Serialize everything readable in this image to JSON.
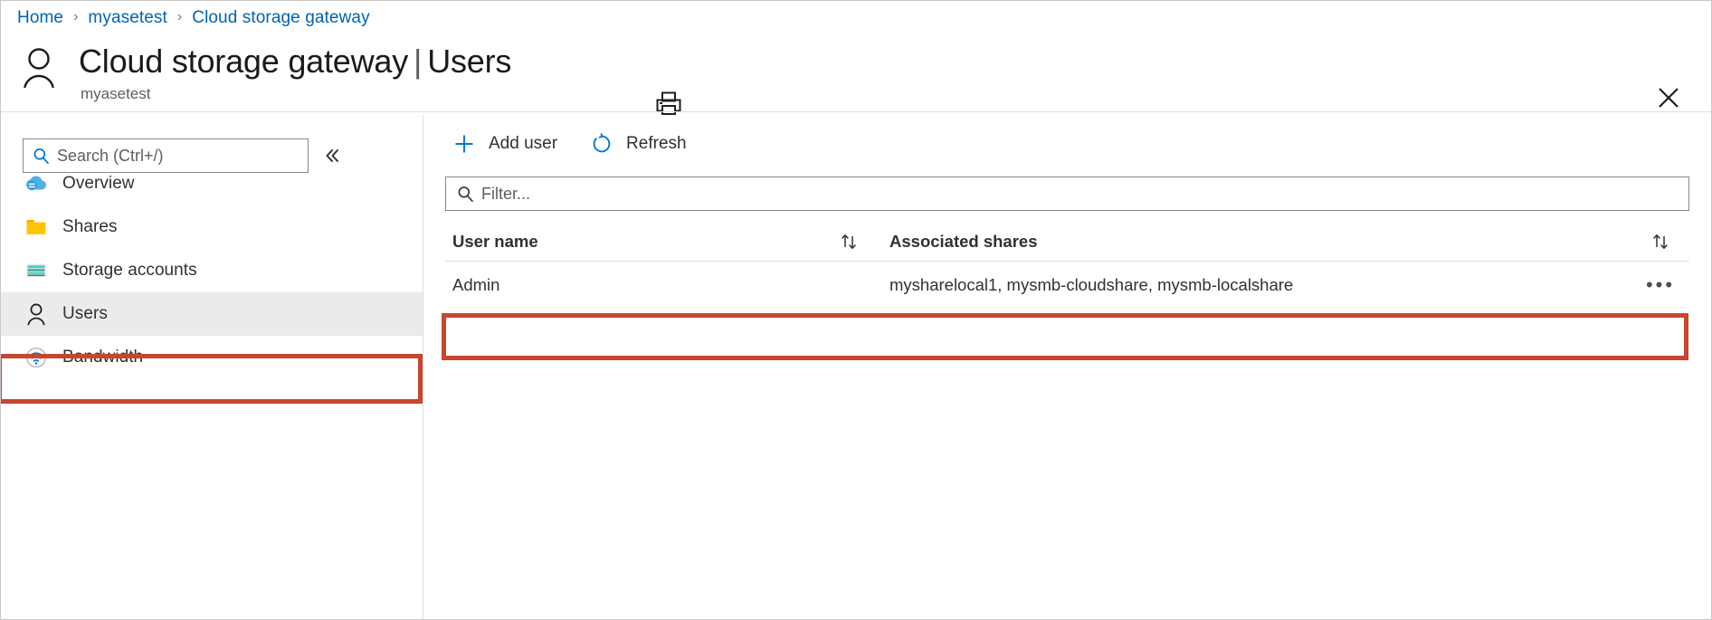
{
  "breadcrumb": {
    "items": [
      {
        "label": "Home"
      },
      {
        "label": "myasetest"
      },
      {
        "label": "Cloud storage gateway"
      }
    ],
    "separator": "›"
  },
  "header": {
    "icon": "user-outline-icon",
    "title": "Cloud storage gateway",
    "title_separator": "|",
    "section": "Users",
    "subtitle": "myasetest",
    "print_icon": "printer-icon",
    "close_icon": "close-icon"
  },
  "sidebar": {
    "search": {
      "placeholder": "Search (Ctrl+/)",
      "value": "",
      "icon": "search-icon"
    },
    "collapse_icon": "chevron-double-left-icon",
    "collapse_label": "«",
    "items": [
      {
        "label": "Overview",
        "icon": "cloud-icon",
        "selected": false
      },
      {
        "label": "Shares",
        "icon": "folder-icon",
        "selected": false
      },
      {
        "label": "Storage accounts",
        "icon": "storage-account-icon",
        "selected": false
      },
      {
        "label": "Users",
        "icon": "user-icon",
        "selected": true
      },
      {
        "label": "Bandwidth",
        "icon": "bandwidth-icon",
        "selected": false
      }
    ]
  },
  "toolbar": {
    "add_user_label": "Add user",
    "add_user_icon": "plus-icon",
    "refresh_label": "Refresh",
    "refresh_icon": "refresh-icon"
  },
  "filter": {
    "placeholder": "Filter...",
    "value": "",
    "icon": "search-icon"
  },
  "table": {
    "columns": [
      {
        "key": "user_name",
        "label": "User name",
        "sortable": true,
        "sort_icon": "sort-updown-icon"
      },
      {
        "key": "associated_shares",
        "label": "Associated shares",
        "sortable": true,
        "sort_icon": "sort-updown-icon"
      }
    ],
    "rows": [
      {
        "user_name": "Admin",
        "associated_shares": "mysharelocal1, mysmb-cloudshare, mysmb-localshare",
        "context_menu_icon": "ellipsis-icon",
        "context_menu_label": "•••"
      }
    ]
  },
  "highlights": {
    "color": "#c8452f",
    "targets": [
      "sidebar-item-users",
      "table-row-admin"
    ]
  },
  "colors": {
    "link": "#0063b1",
    "accent": "#0078d4",
    "selected_bg": "#edebe9",
    "callout_red": "#c8452f",
    "text": "#323130",
    "subtle_text": "#605e5c"
  }
}
